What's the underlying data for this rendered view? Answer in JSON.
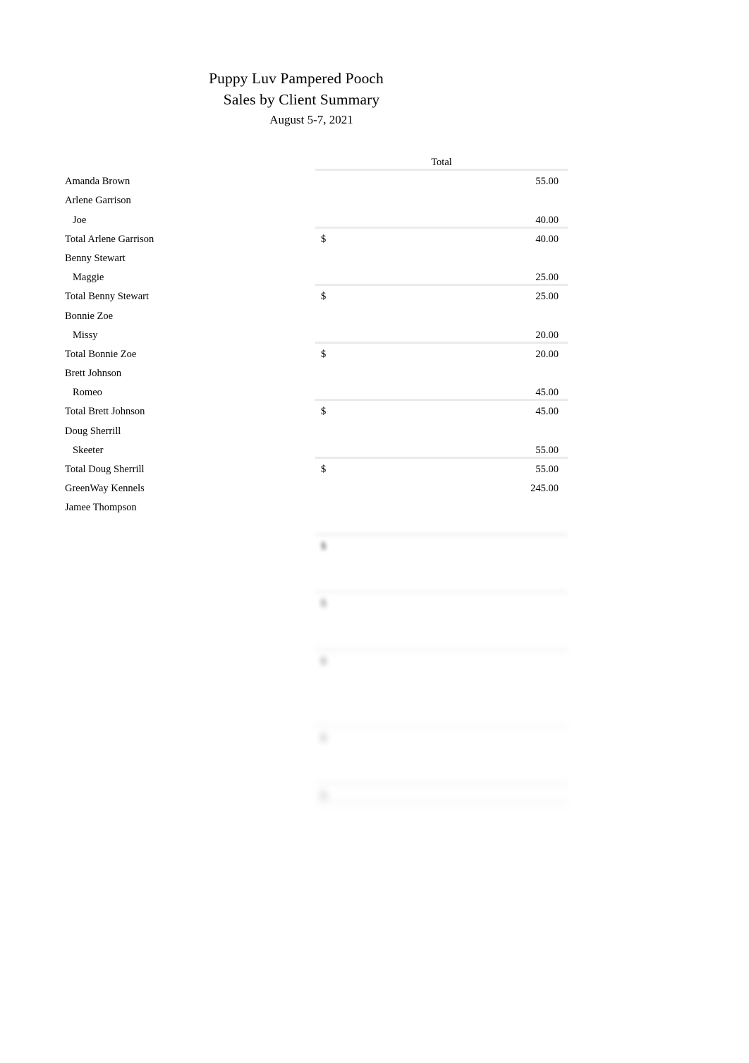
{
  "report": {
    "company": "Puppy Luv Pampered Pooch",
    "title": "Sales by Client Summary",
    "date_range": "August 5-7, 2021",
    "column_header": "Total",
    "currency_symbol": "$"
  },
  "rows": [
    {
      "label": "Amanda Brown",
      "indent": false,
      "currency": "",
      "amount": "55.00",
      "rule": false,
      "blur": 0
    },
    {
      "label": "Arlene Garrison",
      "indent": false,
      "currency": "",
      "amount": "",
      "rule": false,
      "blur": 0
    },
    {
      "label": "Joe",
      "indent": true,
      "currency": "",
      "amount": "40.00",
      "rule": true,
      "blur": 0
    },
    {
      "label": "Total Arlene Garrison",
      "indent": false,
      "currency": "$",
      "amount": "40.00",
      "rule": false,
      "blur": 0
    },
    {
      "label": "Benny Stewart",
      "indent": false,
      "currency": "",
      "amount": "",
      "rule": false,
      "blur": 0
    },
    {
      "label": "Maggie",
      "indent": true,
      "currency": "",
      "amount": "25.00",
      "rule": true,
      "blur": 0
    },
    {
      "label": "Total Benny Stewart",
      "indent": false,
      "currency": "$",
      "amount": "25.00",
      "rule": false,
      "blur": 0
    },
    {
      "label": "Bonnie Zoe",
      "indent": false,
      "currency": "",
      "amount": "",
      "rule": false,
      "blur": 0
    },
    {
      "label": "Missy",
      "indent": true,
      "currency": "",
      "amount": "20.00",
      "rule": true,
      "blur": 0
    },
    {
      "label": "Total Bonnie Zoe",
      "indent": false,
      "currency": "$",
      "amount": "20.00",
      "rule": false,
      "blur": 0
    },
    {
      "label": "Brett Johnson",
      "indent": false,
      "currency": "",
      "amount": "",
      "rule": false,
      "blur": 0
    },
    {
      "label": "Romeo",
      "indent": true,
      "currency": "",
      "amount": "45.00",
      "rule": true,
      "blur": 0
    },
    {
      "label": "Total Brett Johnson",
      "indent": false,
      "currency": "$",
      "amount": "45.00",
      "rule": false,
      "blur": 0
    },
    {
      "label": "Doug Sherrill",
      "indent": false,
      "currency": "",
      "amount": "",
      "rule": false,
      "blur": 0
    },
    {
      "label": "Skeeter",
      "indent": true,
      "currency": "",
      "amount": "55.00",
      "rule": true,
      "blur": 0
    },
    {
      "label": "Total Doug Sherrill",
      "indent": false,
      "currency": "$",
      "amount": "55.00",
      "rule": false,
      "blur": 0
    },
    {
      "label": "GreenWay Kennels",
      "indent": false,
      "currency": "",
      "amount": "245.00",
      "rule": false,
      "blur": 0
    },
    {
      "label": "Jamee Thompson",
      "indent": false,
      "currency": "",
      "amount": "",
      "rule": false,
      "blur": 0
    },
    {
      "label": "",
      "indent": true,
      "currency": "",
      "amount": "",
      "rule": true,
      "blur": 1
    },
    {
      "label": "",
      "indent": false,
      "currency": "$",
      "amount": "",
      "rule": false,
      "blur": 1
    },
    {
      "label": "",
      "indent": false,
      "currency": "",
      "amount": "",
      "rule": false,
      "blur": 2
    },
    {
      "label": "",
      "indent": true,
      "currency": "",
      "amount": "",
      "rule": true,
      "blur": 2
    },
    {
      "label": "",
      "indent": false,
      "currency": "$",
      "amount": "",
      "rule": false,
      "blur": 2
    },
    {
      "label": "",
      "indent": false,
      "currency": "",
      "amount": "",
      "rule": false,
      "blur": 3
    },
    {
      "label": "",
      "indent": true,
      "currency": "",
      "amount": "",
      "rule": true,
      "blur": 3
    },
    {
      "label": "",
      "indent": false,
      "currency": "$",
      "amount": "",
      "rule": false,
      "blur": 3
    },
    {
      "label": "",
      "indent": false,
      "currency": "",
      "amount": "",
      "rule": false,
      "blur": 4
    },
    {
      "label": "",
      "indent": true,
      "currency": "",
      "amount": "",
      "rule": false,
      "blur": 4
    },
    {
      "label": "",
      "indent": true,
      "currency": "",
      "amount": "",
      "rule": true,
      "blur": 4
    },
    {
      "label": "",
      "indent": false,
      "currency": "$",
      "amount": "",
      "rule": false,
      "blur": 5
    },
    {
      "label": "",
      "indent": false,
      "currency": "",
      "amount": "",
      "rule": false,
      "blur": 5
    },
    {
      "label": "",
      "indent": true,
      "currency": "",
      "amount": "",
      "rule": true,
      "blur": 5
    },
    {
      "label": "",
      "indent": false,
      "currency": "$",
      "amount": "",
      "rule": true,
      "blur": 6
    },
    {
      "label": "",
      "indent": false,
      "currency": "",
      "amount": "",
      "rule": false,
      "blur": 6
    }
  ],
  "footer": {
    "left": "",
    "right": ""
  }
}
